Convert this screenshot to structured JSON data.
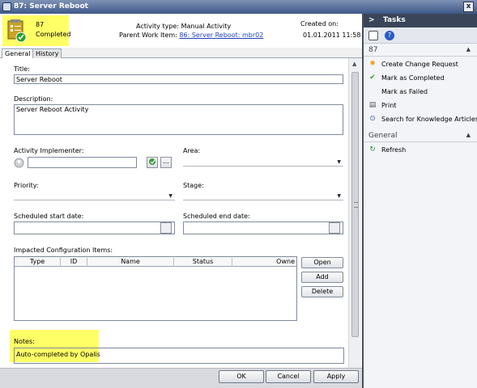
{
  "window": {
    "title": "87: Server Reboot",
    "close_glyph": "x"
  },
  "header": {
    "id": "87",
    "status": "Completed",
    "activity_type": "Activity type: Manual Activity",
    "parent_label": "Parent Work Item:",
    "parent_link": "86: Server Reboot: mbr02",
    "created_label": "Created on:",
    "created_value": "01.01.2011 11:58",
    "highlight_color": "#ffff66"
  },
  "tabs": [
    {
      "label": "General"
    },
    {
      "label": "History"
    }
  ],
  "form": {
    "title_label": "Title:",
    "title_value": "Server Reboot",
    "description_label": "Description:",
    "description_value": "Server Reboot Activity",
    "implementer_label": "Activity Implementer:",
    "implementer_value": "",
    "browse_glyph": "...",
    "area_label": "Area:",
    "area_value": "",
    "priority_label": "Priority:",
    "priority_value": "",
    "stage_label": "Stage:",
    "stage_value": "",
    "start_label": "Scheduled start date:",
    "end_label": "Scheduled end date:",
    "ci_label": "Impacted Configuration Items:",
    "ci_columns": [
      "Type",
      "ID",
      "Name",
      "Status",
      "Owne"
    ],
    "ci_buttons": {
      "open": "Open",
      "add": "Add",
      "delete": "Delete"
    },
    "notes_label": "Notes:",
    "notes_value": "Auto-completed by Opalis"
  },
  "footer": {
    "ok": "OK",
    "cancel": "Cancel",
    "apply": "Apply"
  },
  "tasks": {
    "title": "Tasks",
    "chevron": ">",
    "section1": "87",
    "items": [
      {
        "label": "Create Change Request",
        "icon": "sun-icon",
        "glyph": "✹",
        "color": "#f0a020"
      },
      {
        "label": "Mark as Completed",
        "icon": "checkmark-icon",
        "glyph": "✔",
        "color": "#2aa02a"
      },
      {
        "label": "Mark as Failed",
        "icon": "",
        "glyph": "",
        "color": ""
      },
      {
        "label": "Print",
        "icon": "printer-icon",
        "glyph": "▤",
        "color": "#555555"
      },
      {
        "label": "Search for Knowledge Articles",
        "icon": "search-icon",
        "glyph": "⊙",
        "color": "#4060a0"
      }
    ],
    "section2": "General",
    "general_items": [
      {
        "label": "Refresh",
        "icon": "refresh-icon",
        "glyph": "↻",
        "color": "#2a8a3a"
      }
    ],
    "collapse_glyph": "▲"
  }
}
